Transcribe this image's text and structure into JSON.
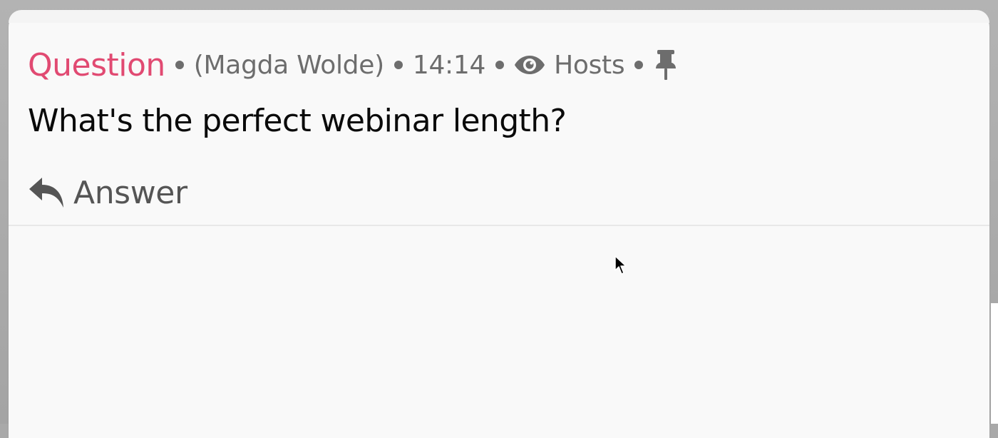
{
  "card": {
    "type_label": "Question",
    "author": "(Magda Wolde)",
    "time": "14:14",
    "visibility_icon": "eye-icon",
    "visibility_label": "Hosts",
    "pin_icon": "thumbtack-icon",
    "question_text": "What's the perfect webinar length?",
    "answer_icon": "reply-icon",
    "answer_label": "Answer"
  },
  "colors": {
    "type_label": "#e14a72",
    "meta_text": "#6d6d6d",
    "question_text": "#0a0a0a",
    "answer_text": "#555555",
    "card_background": "#f9f9f9"
  }
}
